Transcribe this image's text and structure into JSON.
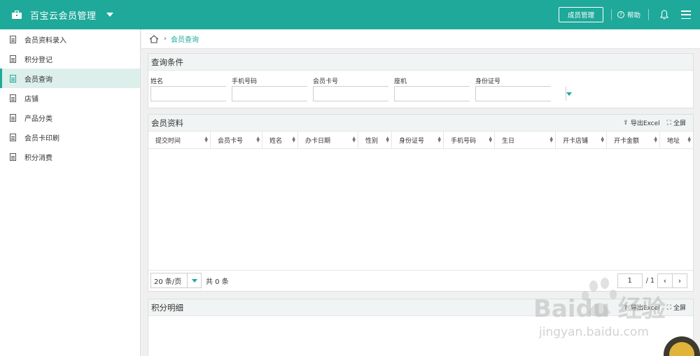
{
  "header": {
    "title": "百宝云会员管理",
    "member_btn": "成员管理",
    "help": "帮助"
  },
  "sidebar": {
    "items": [
      {
        "label": "会员资料录入"
      },
      {
        "label": "积分登记"
      },
      {
        "label": "会员查询"
      },
      {
        "label": "店铺"
      },
      {
        "label": "产品分类"
      },
      {
        "label": "会员卡印刷"
      },
      {
        "label": "积分消费"
      }
    ],
    "active_index": 2
  },
  "breadcrumb": {
    "current": "会员查询"
  },
  "query": {
    "title": "查询条件",
    "fields": [
      {
        "label": "姓名",
        "value": ""
      },
      {
        "label": "手机号码",
        "value": ""
      },
      {
        "label": "会员卡号",
        "value": ""
      },
      {
        "label": "座机",
        "value": ""
      },
      {
        "label": "身份证号",
        "value": ""
      }
    ]
  },
  "member_table": {
    "title": "会员资料",
    "export": "导出Excel",
    "fullscreen": "全屏",
    "columns": [
      "提交时间",
      "会员卡号",
      "姓名",
      "办卡日期",
      "性别",
      "身份证号",
      "手机号码",
      "生日",
      "开卡店铺",
      "开卡金额",
      "地址"
    ],
    "rows": [],
    "page_size": "20 条/页",
    "total": "共 0 条",
    "page": "1",
    "page_of": "/ 1"
  },
  "points_table": {
    "title": "积分明细",
    "export": "导出Excel",
    "fullscreen": "全屏"
  },
  "watermark": {
    "brand": "Baidu 经验",
    "url": "jingyan.baidu.com"
  },
  "colors": {
    "accent": "#1fa99a",
    "active_bg": "#dcefeb"
  }
}
